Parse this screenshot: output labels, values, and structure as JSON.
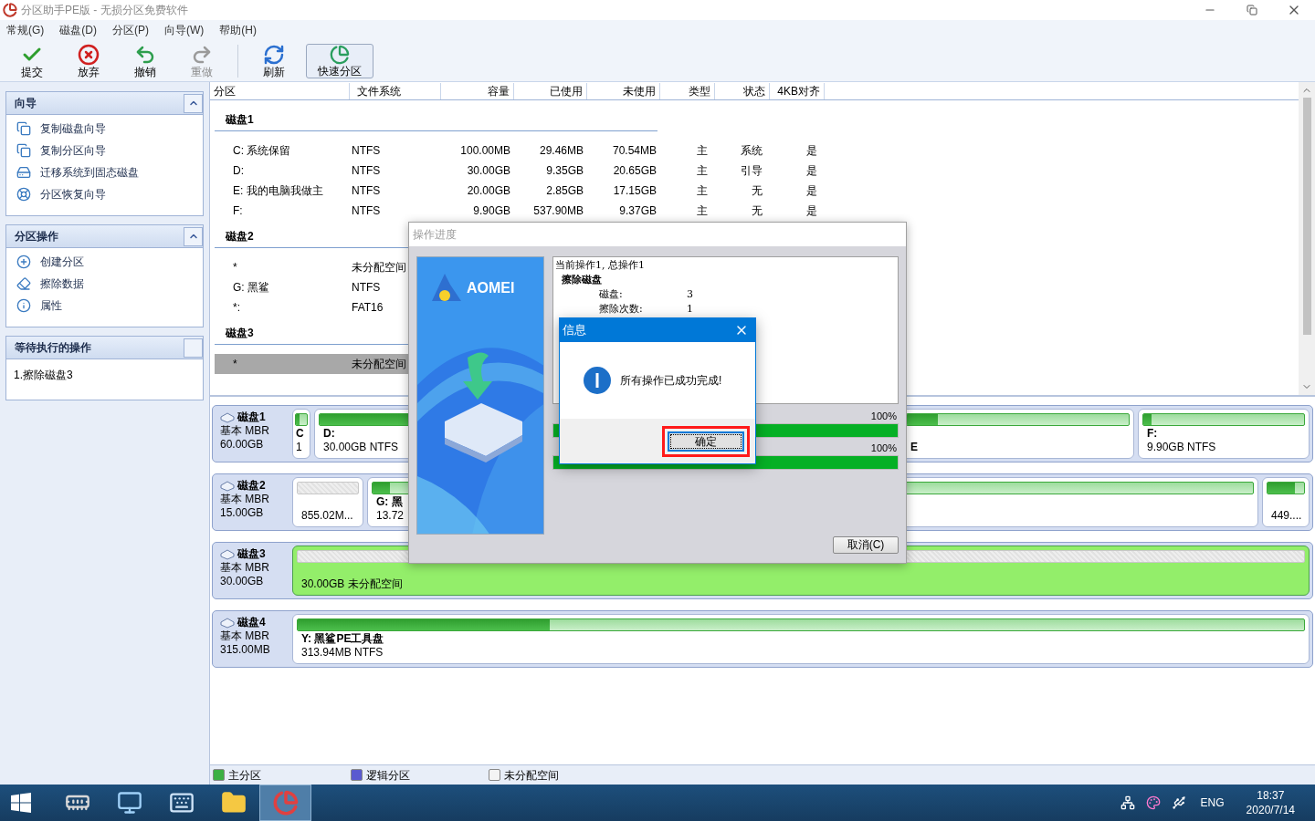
{
  "window": {
    "title": "分区助手PE版 - 无损分区免费软件"
  },
  "menu": [
    {
      "label": "常规(G)"
    },
    {
      "label": "磁盘(D)"
    },
    {
      "label": "分区(P)"
    },
    {
      "label": "向导(W)"
    },
    {
      "label": "帮助(H)"
    }
  ],
  "toolbar": [
    {
      "label": "提交",
      "disabled": false,
      "hovered": false
    },
    {
      "label": "放弃",
      "disabled": false,
      "hovered": false
    },
    {
      "label": "撤销",
      "disabled": false,
      "hovered": false
    },
    {
      "label": "重做",
      "disabled": true,
      "hovered": false
    },
    {
      "label": "刷新",
      "disabled": false,
      "hovered": false
    },
    {
      "label": "快速分区",
      "disabled": false,
      "hovered": true
    }
  ],
  "sidebar": {
    "sections": [
      {
        "title": "向导",
        "expanded": true,
        "kind": "links",
        "items": [
          {
            "label": "复制磁盘向导"
          },
          {
            "label": "复制分区向导"
          },
          {
            "label": "迁移系统到固态磁盘"
          },
          {
            "label": "分区恢复向导"
          }
        ]
      },
      {
        "title": "分区操作",
        "expanded": true,
        "kind": "links",
        "items": [
          {
            "label": "创建分区"
          },
          {
            "label": "擦除数据"
          },
          {
            "label": "属性"
          }
        ]
      },
      {
        "title": "等待执行的操作",
        "kind": "pending",
        "items": [
          {
            "label": "1.擦除磁盘3"
          }
        ]
      }
    ]
  },
  "table": {
    "columns": [
      "分区",
      "文件系统",
      "容量",
      "已使用",
      "未使用",
      "类型",
      "状态",
      "4KB对齐"
    ],
    "disks": [
      {
        "title": "磁盘1",
        "rows": [
          {
            "selected": false,
            "cells": [
              "C: 系统保留",
              "NTFS",
              "100.00MB",
              "29.46MB",
              "70.54MB",
              "主",
              "系统",
              "是"
            ]
          },
          {
            "selected": false,
            "cells": [
              "D:",
              "NTFS",
              "30.00GB",
              "9.35GB",
              "20.65GB",
              "主",
              "引导",
              "是"
            ]
          },
          {
            "selected": false,
            "cells": [
              "E: 我的电脑我做主",
              "NTFS",
              "20.00GB",
              "2.85GB",
              "17.15GB",
              "主",
              "无",
              "是"
            ]
          },
          {
            "selected": false,
            "cells": [
              "F:",
              "NTFS",
              "9.90GB",
              "537.90MB",
              "9.37GB",
              "主",
              "无",
              "是"
            ]
          }
        ]
      },
      {
        "title": "磁盘2",
        "rows": [
          {
            "selected": false,
            "cells": [
              "*",
              "未分配空间"
            ]
          },
          {
            "selected": false,
            "cells": [
              "G: 黑鲨",
              "NTFS"
            ]
          },
          {
            "selected": false,
            "cells": [
              "*:",
              "FAT16"
            ]
          }
        ]
      },
      {
        "title": "磁盘3",
        "rows": [
          {
            "selected": true,
            "cells": [
              "*",
              "未分配空间"
            ]
          }
        ]
      }
    ]
  },
  "disk_map": [
    {
      "name": "磁盘1",
      "type": "基本 MBR",
      "size": "60.00GB",
      "partitions": [
        {
          "kind": "primary",
          "selected": false,
          "level": 0.3,
          "label": "C",
          "detail": "1"
        },
        {
          "kind": "primary",
          "selected": false,
          "level": 0.31,
          "label": "D:",
          "detail": "30.00GB NTFS"
        },
        {
          "kind": "primary",
          "selected": false,
          "level": 0.14,
          "label": "E"
        },
        {
          "kind": "primary",
          "selected": false,
          "level": 0.05,
          "label": "F:",
          "detail": "9.90GB NTFS"
        }
      ]
    },
    {
      "name": "磁盘2",
      "type": "基本 MBR",
      "size": "15.00GB",
      "partitions": [
        {
          "kind": "unallocated",
          "selected": false,
          "detail": "855.02M..."
        },
        {
          "kind": "primary",
          "selected": false,
          "level": 0.02,
          "label": "G: 黑",
          "detail": "13.72"
        },
        {
          "kind": "primary",
          "selected": false,
          "level": 0.75,
          "detail": "449...."
        }
      ]
    },
    {
      "name": "磁盘3",
      "type": "基本 MBR",
      "size": "30.00GB",
      "partitions": [
        {
          "kind": "unallocated",
          "selected": true,
          "detail": "30.00GB 未分配空间"
        }
      ]
    },
    {
      "name": "磁盘4",
      "type": "基本 MBR",
      "size": "315.00MB",
      "partitions": [
        {
          "kind": "primary",
          "selected": false,
          "level": 0.25,
          "label": "Y: 黑鲨PE工具盘",
          "detail": "313.94MB NTFS"
        }
      ]
    }
  ],
  "legend": [
    {
      "label": "主分区",
      "color": "#3cb043"
    },
    {
      "label": "逻辑分区",
      "color": "#5a5ad0"
    },
    {
      "label": "未分配空间",
      "color": "#f4f4f4"
    }
  ],
  "progress_dialog": {
    "title": "操作进度",
    "brand": "AOMEI",
    "log": {
      "heading": "当前操作1, 总操作1",
      "operation": "擦除磁盘",
      "details": [
        {
          "name": "磁盘:",
          "value": "3"
        },
        {
          "name": "擦除次数:",
          "value": "1"
        }
      ]
    },
    "bars": [
      {
        "reading": "100%",
        "level": 1
      },
      {
        "reading": "100%",
        "level": 1
      }
    ],
    "cancel": "取消(C)"
  },
  "message_box": {
    "title": "信息",
    "message": "所有操作已成功完成!",
    "button": {
      "label": "确定",
      "annotated": true
    }
  },
  "taskbar": {
    "apps": [
      {
        "active": false
      },
      {
        "active": false
      },
      {
        "active": false
      },
      {
        "active": false
      },
      {
        "active": true
      }
    ],
    "language": "ENG",
    "time": "18:37",
    "date": "2020/7/14"
  }
}
